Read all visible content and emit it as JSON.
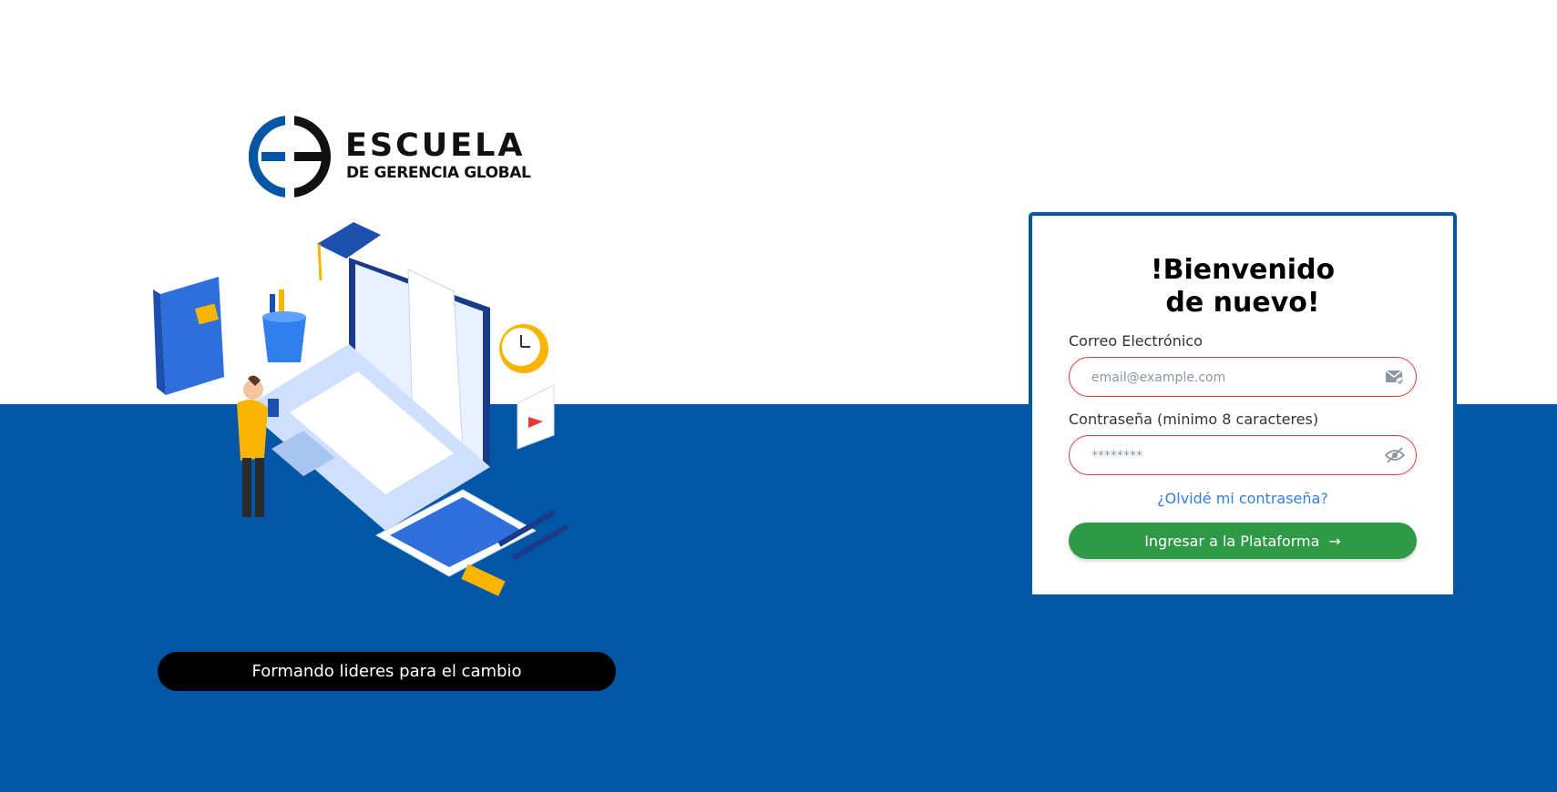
{
  "brand": {
    "name_line1": "ESCUELA",
    "name_line2": "DE GERENCIA GLOBAL",
    "slogan": "Formando lideres para el cambio"
  },
  "login": {
    "title_line1": "!Bienvenido",
    "title_line2": "de nuevo!",
    "email_label": "Correo Electrónico",
    "email_placeholder": "email@example.com",
    "password_label": "Contraseña (minimo 8 caracteres)",
    "password_placeholder": "********",
    "forgot_link": "¿Olvidé mi contraseña?",
    "submit_label": "Ingresar a la Plataforma"
  },
  "icons": {
    "email_field": "mail-check-icon",
    "password_field": "eye-off-icon",
    "submit": "arrow-right-icon"
  },
  "colors": {
    "primary_blue": "#0157a6",
    "submit_green": "#2e9a45",
    "field_border_error": "#e53935",
    "link_blue": "#2f80d6"
  }
}
